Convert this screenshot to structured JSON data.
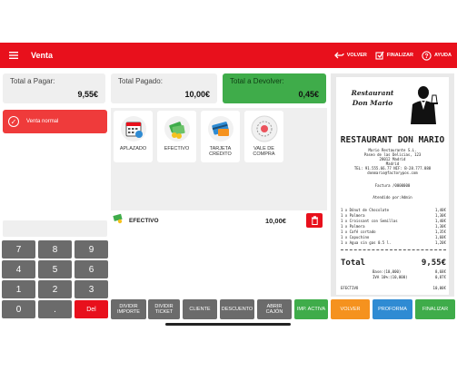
{
  "header": {
    "title": "Venta",
    "actions": [
      {
        "label": "VOLVER",
        "icon": "back-arrow-icon"
      },
      {
        "label": "FINALIZAR",
        "icon": "edit-check-icon"
      },
      {
        "label": "AYUDA",
        "icon": "help-icon"
      }
    ]
  },
  "summary": {
    "to_pay_label": "Total a Pagar:",
    "to_pay_value": "9,55€",
    "paid_label": "Total Pagado:",
    "paid_value": "10,00€",
    "return_label": "Total a Devolver:",
    "return_value": "0,45€"
  },
  "mode": {
    "label": "Venta normal"
  },
  "keypad": [
    "7",
    "8",
    "9",
    "4",
    "5",
    "6",
    "1",
    "2",
    "3",
    "0",
    ".",
    "Del"
  ],
  "payment_methods": [
    {
      "label": "APLAZADO",
      "icon": "calendar-icon"
    },
    {
      "label": "EFECTIVO",
      "icon": "cash-icon"
    },
    {
      "label": "TARJETA\nCRÉDITO",
      "icon": "credit-card-icon"
    },
    {
      "label": "VALE DE\nCOMPRA",
      "icon": "voucher-icon"
    }
  ],
  "payment_line": {
    "method": "EFECTIVO",
    "amount": "10,00€"
  },
  "bottom_buttons": [
    {
      "label": "DIVIDIR\nIMPORTE",
      "color": "#6b6b6b"
    },
    {
      "label": "DIVIDIR\nTICKET",
      "color": "#6b6b6b"
    },
    {
      "label": "CLIENTE",
      "color": "#6b6b6b"
    },
    {
      "label": "DESCUENTO",
      "color": "#6b6b6b"
    },
    {
      "label": "ABRIR\nCAJÓN",
      "color": "#6b6b6b"
    },
    {
      "label": "IMP. ACTIVA",
      "color": "#3fac4a"
    },
    {
      "label": "VOLVER",
      "color": "#f5921e"
    },
    {
      "label": "PROFORMA",
      "color": "#2f8bd3"
    },
    {
      "label": "FINALIZAR",
      "color": "#3fac4a"
    }
  ],
  "receipt": {
    "logo_line1": "Restaurant",
    "logo_line2": "Don Mario",
    "title": "RESTAURANT DON MARIO",
    "address_lines": [
      "Mario Restaurante S.L.",
      "Paseo de las Delicias, 123",
      "28012 Madrid",
      "Madrid",
      "TEL: 91.555.66.77 NIF: B-28.777.888",
      "donmario@factorypos.com"
    ],
    "invoice": "Factura /0000000",
    "attended": "Atendido por:Admin",
    "items": [
      {
        "desc": "1 x Dónut de Chocolate",
        "price": "1,40€"
      },
      {
        "desc": "1 x Palmera",
        "price": "1,30€"
      },
      {
        "desc": "1 x Croissant con Semillas",
        "price": "1,40€"
      },
      {
        "desc": "1 x Palmera",
        "price": "1,30€"
      },
      {
        "desc": "1 x Café cortado",
        "price": "1,35€"
      },
      {
        "desc": "1 x Capuchino",
        "price": "1,60€"
      },
      {
        "desc": "1 x Agua sin gas 0.5 l.",
        "price": "1,20€"
      }
    ],
    "total_label": "Total",
    "total_value": "9,55€",
    "tax_lines": [
      {
        "label": "Base:(10,000)",
        "value": "8,68€"
      },
      {
        "label": "IVA 10%:(10,000)",
        "value": "0,87€"
      }
    ],
    "payment_lines": [
      {
        "label": "EFECTIVO",
        "value": "10,00€"
      }
    ]
  },
  "colors": {
    "brand_red": "#e8101c",
    "green": "#3fac4a",
    "orange": "#f5921e",
    "blue": "#2f8bd3",
    "grey": "#6b6b6b"
  }
}
